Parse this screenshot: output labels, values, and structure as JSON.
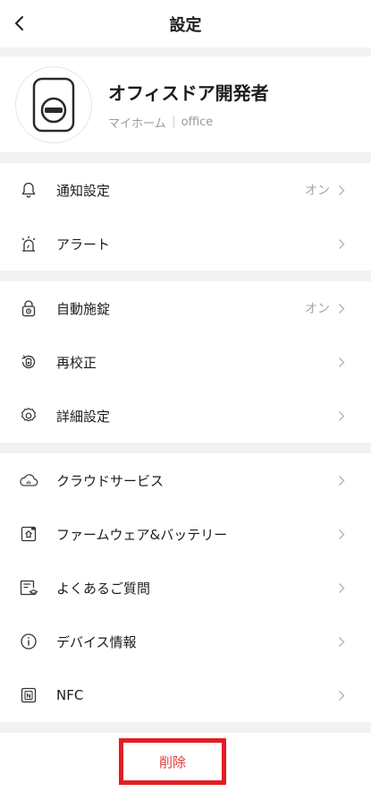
{
  "header": {
    "title": "設定"
  },
  "profile": {
    "name": "オフィスドア開発者",
    "home": "マイホーム",
    "room": "office"
  },
  "groups": [
    {
      "items": [
        {
          "label": "通知設定",
          "value": "オン",
          "icon": "bell-icon"
        },
        {
          "label": "アラート",
          "value": "",
          "icon": "alarm-siren-icon"
        }
      ]
    },
    {
      "items": [
        {
          "label": "自動施錠",
          "value": "オン",
          "icon": "auto-lock-icon"
        },
        {
          "label": "再校正",
          "value": "",
          "icon": "recalibrate-icon"
        },
        {
          "label": "詳細設定",
          "value": "",
          "icon": "gear-icon"
        }
      ]
    },
    {
      "items": [
        {
          "label": "クラウドサービス",
          "value": "",
          "icon": "cloud-icon"
        },
        {
          "label": "ファームウェア&バッテリー",
          "value": "",
          "icon": "firmware-icon"
        },
        {
          "label": "よくあるご質問",
          "value": "",
          "icon": "faq-icon"
        },
        {
          "label": "デバイス情報",
          "value": "",
          "icon": "info-icon"
        },
        {
          "label": "NFC",
          "value": "",
          "icon": "nfc-icon"
        }
      ]
    }
  ],
  "delete_label": "削除",
  "colors": {
    "accent_red": "#e31d24",
    "delete_text": "#e23b3b"
  }
}
